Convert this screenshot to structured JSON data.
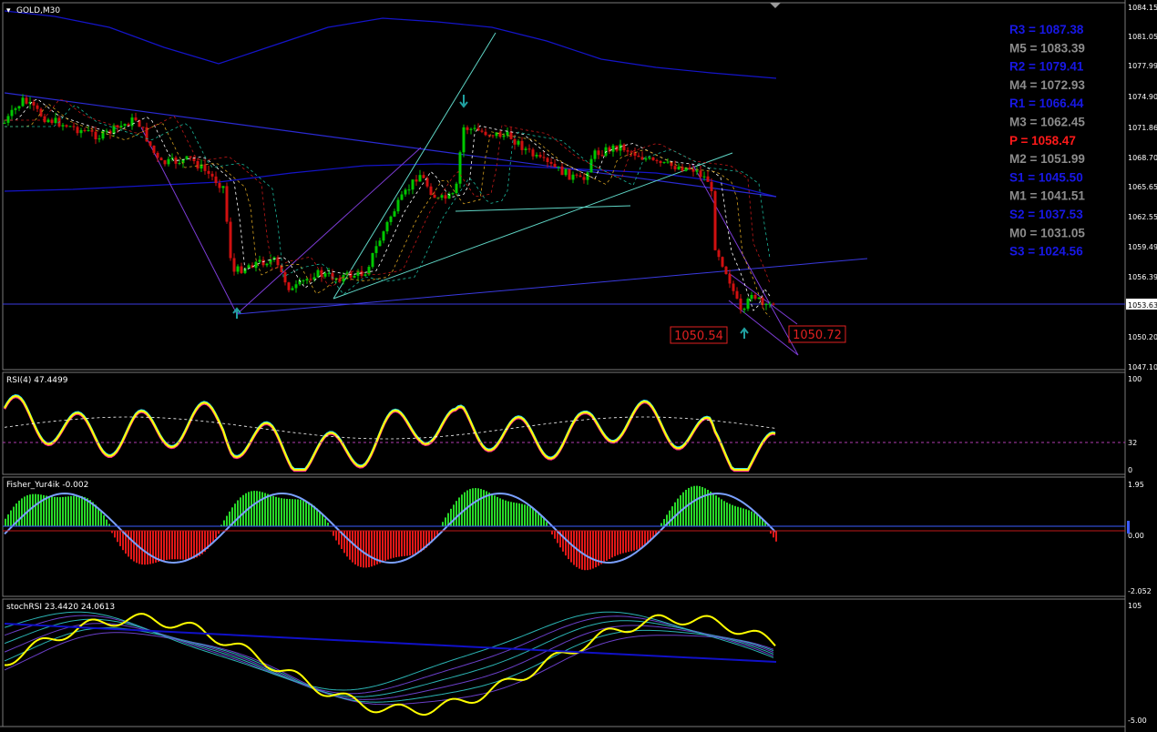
{
  "main": {
    "title": "GOLD,M30",
    "price_axis": [
      "1084.15",
      "1081.05",
      "1077.99",
      "1074.90",
      "1071.86",
      "1068.70",
      "1065.65",
      "1062.55",
      "1059.49",
      "1056.39",
      "1053.63",
      "1050.20",
      "1047.10"
    ],
    "current_price": "1053.63",
    "marker_left": "1050.54",
    "marker_right": "1050.72",
    "pivots": [
      {
        "label": "R3 = 1087.38",
        "color": "#1818e6"
      },
      {
        "label": "M5 = 1083.39",
        "color": "#8c8c8c"
      },
      {
        "label": "R2 = 1079.41",
        "color": "#1818e6"
      },
      {
        "label": "M4 = 1072.93",
        "color": "#8c8c8c"
      },
      {
        "label": "R1 = 1066.44",
        "color": "#1818e6"
      },
      {
        "label": "M3 = 1062.45",
        "color": "#8c8c8c"
      },
      {
        "label": "P  = 1058.47",
        "color": "#ff1a1a"
      },
      {
        "label": "M2 = 1051.99",
        "color": "#8c8c8c"
      },
      {
        "label": "S1 = 1045.50",
        "color": "#1818e6"
      },
      {
        "label": "M1 = 1041.51",
        "color": "#8c8c8c"
      },
      {
        "label": "S2 = 1037.53",
        "color": "#1818e6"
      },
      {
        "label": "M0 = 1031.05",
        "color": "#8c8c8c"
      },
      {
        "label": "S3 = 1024.56",
        "color": "#1818e6"
      }
    ]
  },
  "rsi": {
    "title": "RSI(4) 47.4499",
    "axis": [
      "100",
      "32",
      "0"
    ]
  },
  "fisher": {
    "title": "Fisher_Yur4ik -0.002",
    "axis": [
      "1.95",
      "0.00",
      "-2.052"
    ]
  },
  "stoch": {
    "title": "stochRSI 23.4420 24.0613",
    "axis": [
      "105",
      "-5.00"
    ]
  },
  "colors": {
    "bull": "#00c800",
    "bear": "#d01010",
    "rsi": "#ffff00",
    "band": "#1010c8"
  }
}
